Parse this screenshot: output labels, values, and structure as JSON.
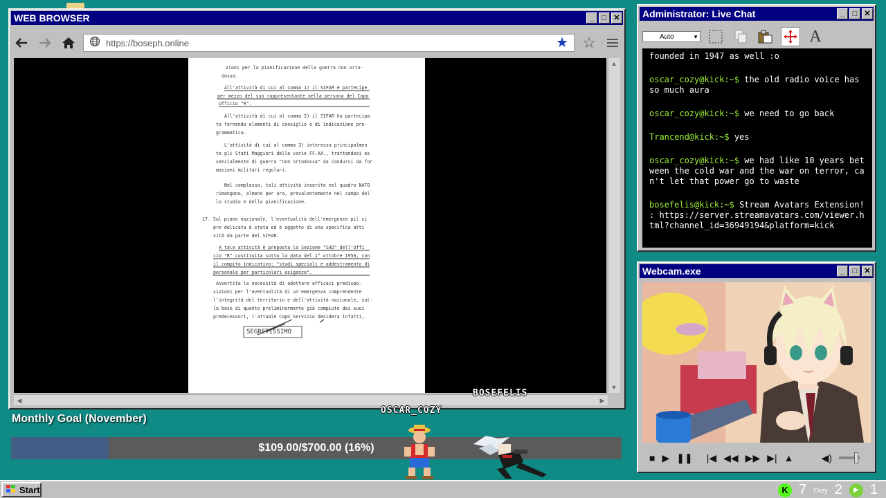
{
  "browser": {
    "title": "WEB BROWSER",
    "url": "https://boseph.online",
    "document_lines": [
      "zioni per la pianificazione della guerra non orto-",
      "dossa.",
      "All'attività di cui al comma 1) il SIFAR è partecipe",
      "per mezzo del suo rappresentante nella persona del Capo",
      "Ufficio \"R\".",
      "All'attività di cui al comma 2) il SIFAR ha partecipa",
      "to fornendo elementi di consiglio e di indicazione pro-",
      "grammatica.",
      "L'attività di cui al comma 3) interessa principalmen",
      "te gli Stati Maggiori delle varie FF.AA., trattandosi es",
      "senzialmente di guerra \"non ortodossa\" da condursi da for",
      "mazioni militari regolari.",
      "Nel complesso, tali attività inserite nel quadro NATO",
      "rimangono, almeno per ora, prevalentemente nel campo del",
      "lo studio e della pianificazione.",
      "17. Sul piano nazionale, l'eventualità dell'emergenza pil si",
      "pre delicata è stata ed è oggetto di una specifica atti",
      "vità da parte del SIFAR.",
      "A tale attività è preposta la Sezione \"SAD\" dell'Uffi",
      "cio \"R\" costituita sotto la data del 1° ottobre 1956, con",
      "il compito indicativo: \"studi speciali e addestramento di",
      "personale per particolari esigenze\".",
      "Avvertita la necessità di adottare efficaci predispo-",
      "sizioni per l'eventualità di un'emergenza comprendente",
      "l'integrità del territorio e dell'attività nazionale, sul-",
      "la base di quanto preliminarmente già compiuto dai suoi",
      "predecessori, l'attuale Capo Servizio desidera infatti,",
      "SEGRETISSIMO"
    ]
  },
  "chat": {
    "title": "Administrator: Live Chat",
    "font_select": "Auto",
    "messages": [
      {
        "user": "",
        "text": "founded in 1947 as well :o"
      },
      {
        "user": "oscar_cozy@kick:~$",
        "text": "the old radio voice has so much aura"
      },
      {
        "user": "oscar_cozy@kick:~$",
        "text": "we need to go back"
      },
      {
        "user": "Trancend@kick:~$",
        "text": "yes"
      },
      {
        "user": "oscar_cozy@kick:~$",
        "text": "we had like 10 years between the cold war and the war on terror, can't let that power go to waste"
      },
      {
        "user": "bosefelis@kick:~$",
        "text": "Stream Avatars Extension! : https://server.streamavatars.com/viewer.html?channel_id=36949194&platform=kick"
      }
    ]
  },
  "webcam": {
    "title": "Webcam.exe"
  },
  "goal": {
    "title": "Monthly Goal (November)",
    "text": "$109.00/$700.00 (16%)",
    "progress": 0.16
  },
  "avatars": {
    "name1": "OSCAR_COZY",
    "name2": "BOSEFELIS"
  },
  "taskbar": {
    "start_label": "Start",
    "tray_num1": "7",
    "tray_label": "Cozy",
    "tray_num2": "2",
    "tray_num3": "1"
  },
  "colors": {
    "titlebar": "#000080",
    "desktop": "#0f8a84",
    "chat_user": "#9ef03a",
    "goal_fill": "#425e86"
  }
}
